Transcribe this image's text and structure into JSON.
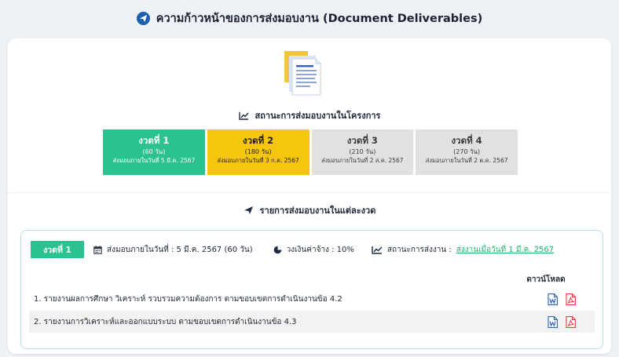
{
  "header": {
    "title": "ความก้าวหน้าของการส่งมอบงาน (Document Deliverables)",
    "icon": "send-circle-icon"
  },
  "status_section": {
    "title": "สถานะการส่งมอบงานในโครงการ",
    "icon": "line-chart-icon"
  },
  "phases": [
    {
      "name": "งวดที่ 1",
      "days": "(60 วัน)",
      "due": "ส่งมอบภายในวันที่ 5 มี.ค. 2567",
      "status_color": "#2bc28d"
    },
    {
      "name": "งวดที่ 2",
      "days": "(180 วัน)",
      "due": "ส่งมอบภายในวันที่ 3 ก.ค. 2567",
      "status_color": "#f6c50e"
    },
    {
      "name": "งวดที่ 3",
      "days": "(210 วัน)",
      "due": "ส่งมอบภายในวันที่ 2 ส.ค. 2567",
      "status_color": "#e1e1e1"
    },
    {
      "name": "งวดที่ 4",
      "days": "(270 วัน)",
      "due": "ส่งมอบภายในวันที่ 2 ต.ค. 2567",
      "status_color": "#e1e1e1"
    }
  ],
  "list_section": {
    "title": "รายการส่งมอบงานในแต่ละงวด",
    "icon": "paper-plane-icon"
  },
  "phase_detail": {
    "badge": "งวดที่ 1",
    "due_text": "ส่งมอบภายในวันที่ : 5 มี.ค. 2567 (60 วัน)",
    "budget_text": "วงเงินค่าจ้าง : 10%",
    "status_label": "สถานะการส่งงาน :",
    "status_link": "ส่งงานเมื่อวันที่ 1 มี.ค. 2567",
    "download_header": "ดาวน์โหลด",
    "deliverables": [
      {
        "title": "1. รายงานผลการศึกษา วิเคราะห์ รวบรวมความต้องการ ตามขอบเขตการดำเนินงานข้อ 4.2"
      },
      {
        "title": "2. รายงานการวิเคราะห์และออกแบบระบบ ตามขอบเขตการดำเนินงานข้อ 4.3"
      }
    ]
  },
  "colors": {
    "accent_green": "#2bc28d",
    "accent_yellow": "#f6c50e",
    "link_green": "#1fb36f",
    "word_blue": "#2b5fb4",
    "pdf_red": "#e0393e"
  }
}
